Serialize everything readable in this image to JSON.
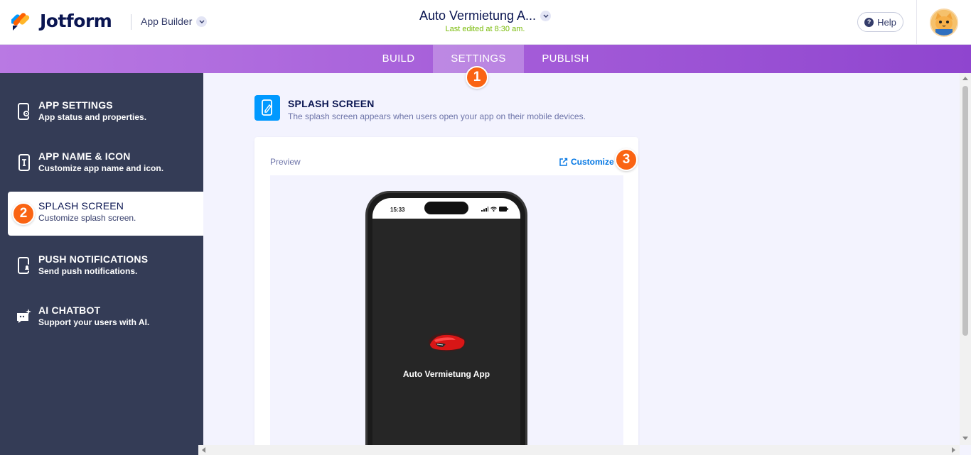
{
  "header": {
    "brand": "Jotform",
    "product_menu": "App Builder",
    "app_title": "Auto Vermietung A...",
    "last_edited": "Last edited at 8:30 am.",
    "help_label": "Help"
  },
  "tabs": [
    {
      "label": "BUILD",
      "active": false
    },
    {
      "label": "SETTINGS",
      "active": true
    },
    {
      "label": "PUBLISH",
      "active": false
    }
  ],
  "step_badges": [
    "1",
    "2",
    "3"
  ],
  "sidebar": {
    "items": [
      {
        "title": "APP SETTINGS",
        "subtitle": "App status and properties.",
        "icon": "phone-gear-icon",
        "active": false
      },
      {
        "title": "APP NAME & ICON",
        "subtitle": "Customize app name and icon.",
        "icon": "phone-text-icon",
        "active": false
      },
      {
        "title": "SPLASH SCREEN",
        "subtitle": "Customize splash screen.",
        "icon": "phone-edit-icon",
        "active": true
      },
      {
        "title": "PUSH NOTIFICATIONS",
        "subtitle": "Send push notifications.",
        "icon": "phone-bell-icon",
        "active": false
      },
      {
        "title": "AI CHATBOT",
        "subtitle": "Support your users with AI.",
        "icon": "chat-sparkle-icon",
        "active": false
      }
    ]
  },
  "section": {
    "title": "SPLASH SCREEN",
    "subtitle": "The splash screen appears when users open your app on their mobile devices."
  },
  "preview": {
    "label": "Preview",
    "customize_label": "Customize",
    "phone_time": "15:33",
    "app_name": "Auto Vermietung App"
  },
  "colors": {
    "accent_orange": "#fa6413",
    "sidebar_bg": "#343c56",
    "tabbar_purple": "#a35bd8",
    "link_blue": "#0075e3",
    "section_icon_blue": "#0099ff"
  }
}
